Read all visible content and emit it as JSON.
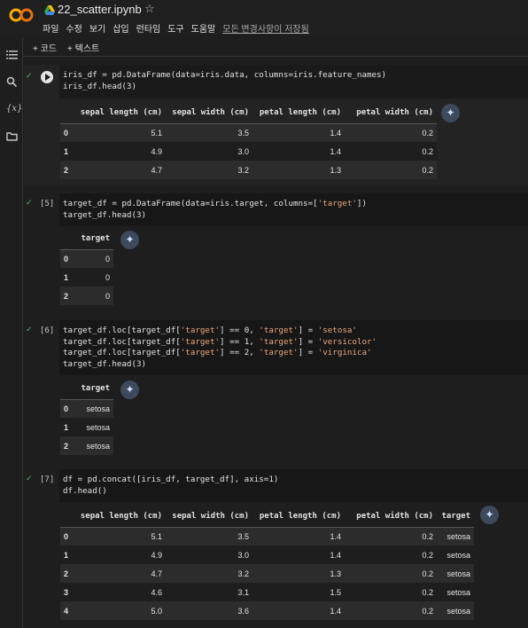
{
  "header": {
    "title": "22_scatter.ipynb",
    "menu": [
      "파일",
      "수정",
      "보기",
      "삽입",
      "런타임",
      "도구",
      "도움말"
    ],
    "save_status": "모든 변경사항이 저장됨"
  },
  "toolbar": {
    "add_code": "+ 코드",
    "add_text": "+ 텍스트"
  },
  "cells": [
    {
      "exec_count": "",
      "code": [
        "iris_df = pd.DataFrame(data=iris.data, columns=iris.feature_names)",
        "iris_df.head(3)"
      ],
      "output": {
        "columns": [
          "",
          "sepal length (cm)",
          "sepal width (cm)",
          "petal length (cm)",
          "petal width (cm)"
        ],
        "rows": [
          [
            "0",
            "5.1",
            "3.5",
            "1.4",
            "0.2"
          ],
          [
            "1",
            "4.9",
            "3.0",
            "1.4",
            "0.2"
          ],
          [
            "2",
            "4.7",
            "3.2",
            "1.3",
            "0.2"
          ]
        ]
      }
    },
    {
      "exec_count": "[5]",
      "code": [
        "target_df = pd.DataFrame(data=iris.target, columns=['target'])",
        "target_df.head(3)"
      ],
      "output": {
        "columns": [
          "",
          "target"
        ],
        "rows": [
          [
            "0",
            "0"
          ],
          [
            "1",
            "0"
          ],
          [
            "2",
            "0"
          ]
        ]
      }
    },
    {
      "exec_count": "[6]",
      "code": [
        "target_df.loc[target_df['target'] == 0, 'target'] = 'setosa'",
        "target_df.loc[target_df['target'] == 1, 'target'] = 'versicolor'",
        "target_df.loc[target_df['target'] == 2, 'target'] = 'virginica'",
        "target_df.head(3)"
      ],
      "output": {
        "columns": [
          "",
          "target"
        ],
        "rows": [
          [
            "0",
            "setosa"
          ],
          [
            "1",
            "setosa"
          ],
          [
            "2",
            "setosa"
          ]
        ]
      }
    },
    {
      "exec_count": "[7]",
      "code": [
        "df = pd.concat([iris_df, target_df], axis=1)",
        "df.head()"
      ],
      "output": {
        "columns": [
          "",
          "sepal length (cm)",
          "sepal width (cm)",
          "petal length (cm)",
          "petal width (cm)",
          "target"
        ],
        "rows": [
          [
            "0",
            "5.1",
            "3.5",
            "1.4",
            "0.2",
            "setosa"
          ],
          [
            "1",
            "4.9",
            "3.0",
            "1.4",
            "0.2",
            "setosa"
          ],
          [
            "2",
            "4.7",
            "3.2",
            "1.3",
            "0.2",
            "setosa"
          ],
          [
            "3",
            "4.6",
            "3.1",
            "1.5",
            "0.2",
            "setosa"
          ],
          [
            "4",
            "5.0",
            "3.6",
            "1.4",
            "0.2",
            "setosa"
          ]
        ]
      }
    }
  ],
  "icons": {
    "logo": "colab-logo",
    "drive": "drive-icon",
    "star": "star-icon",
    "rail": [
      "toc-icon",
      "search-icon",
      "variables-icon",
      "folder-icon"
    ],
    "run": "run-icon",
    "wand": "magic-wand-icon",
    "check": "check-icon"
  }
}
